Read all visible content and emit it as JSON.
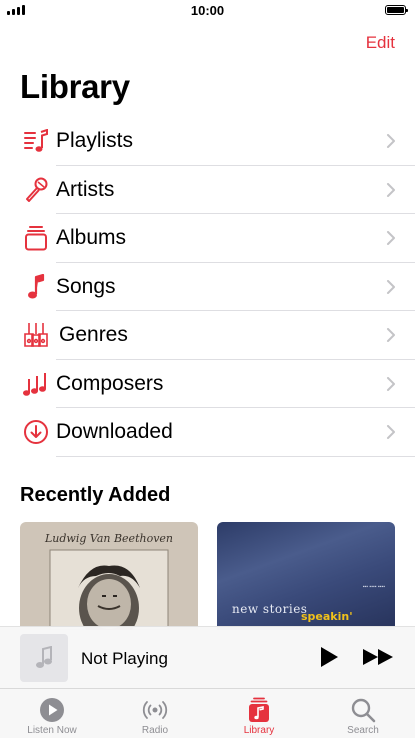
{
  "status_bar": {
    "time": "10:00"
  },
  "header": {
    "edit_label": "Edit",
    "title": "Library"
  },
  "library_items": [
    {
      "label": "Playlists",
      "icon": "playlist-icon"
    },
    {
      "label": "Artists",
      "icon": "microphone-icon"
    },
    {
      "label": "Albums",
      "icon": "album-stack-icon"
    },
    {
      "label": "Songs",
      "icon": "music-note-icon"
    },
    {
      "label": "Genres",
      "icon": "guitars-icon"
    },
    {
      "label": "Composers",
      "icon": "music-notes-icon"
    },
    {
      "label": "Downloaded",
      "icon": "download-circle-icon"
    }
  ],
  "recently_added": {
    "title": "Recently Added",
    "albums": [
      {
        "cover_text": "Ludwig Van Beethoven"
      },
      {
        "cover_text": "new stories",
        "cover_subtext": "speakin'"
      }
    ]
  },
  "mini_player": {
    "title": "Not Playing"
  },
  "tab_bar": {
    "tabs": [
      {
        "label": "Listen Now",
        "icon": "play-circle-icon",
        "active": false
      },
      {
        "label": "Radio",
        "icon": "radio-waves-icon",
        "active": false
      },
      {
        "label": "Library",
        "icon": "library-icon",
        "active": true
      },
      {
        "label": "Search",
        "icon": "search-icon",
        "active": false
      }
    ]
  },
  "colors": {
    "accent": "#e5323e",
    "separator": "#dedee2",
    "tab_inactive": "#8e8e93"
  }
}
